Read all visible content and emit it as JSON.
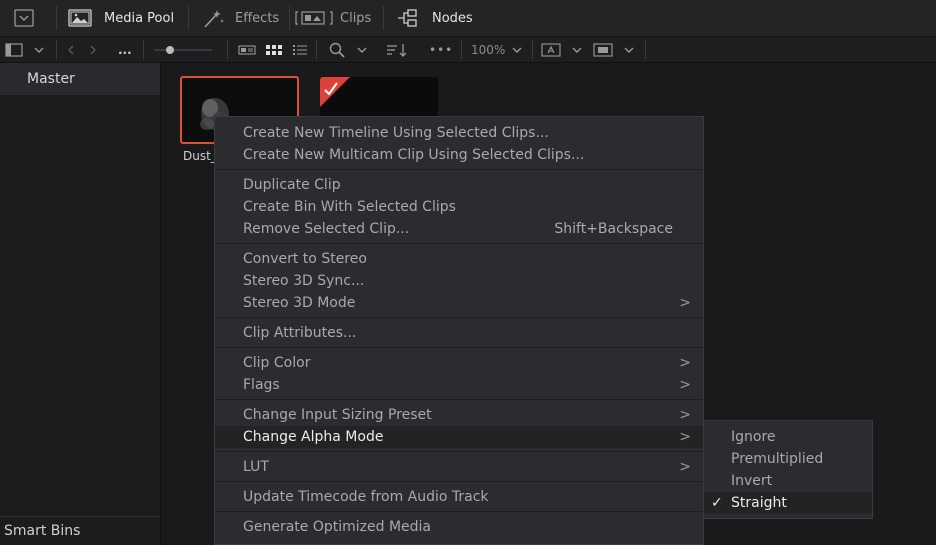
{
  "topbar": {
    "media_pool": "Media Pool",
    "effects": "Effects",
    "clips": "Clips",
    "nodes": "Nodes"
  },
  "toolbar": {
    "path_ellipsis": "...",
    "more": "•••",
    "zoom": "100%"
  },
  "sidebar": {
    "master": "Master",
    "smart_bins": "Smart Bins"
  },
  "clip": {
    "name": "Dust_"
  },
  "context_menu": {
    "items": [
      {
        "label": "Create New Timeline Using Selected Clips..."
      },
      {
        "label": "Create New Multicam Clip Using Selected Clips..."
      },
      {
        "label": "Duplicate Clip"
      },
      {
        "label": "Create Bin With Selected Clips"
      },
      {
        "label": "Remove Selected Clip...",
        "shortcut": "Shift+Backspace"
      },
      {
        "label": "Convert to Stereo"
      },
      {
        "label": "Stereo 3D Sync..."
      },
      {
        "label": "Stereo 3D Mode"
      },
      {
        "label": "Clip Attributes..."
      },
      {
        "label": "Clip Color"
      },
      {
        "label": "Flags"
      },
      {
        "label": "Change Input Sizing Preset"
      },
      {
        "label": "Change Alpha Mode"
      },
      {
        "label": "LUT"
      },
      {
        "label": "Update Timecode from Audio Track"
      },
      {
        "label": "Generate Optimized Media"
      }
    ]
  },
  "alpha_submenu": {
    "items": [
      {
        "label": "Ignore"
      },
      {
        "label": "Premultiplied"
      },
      {
        "label": "Invert"
      },
      {
        "label": "Straight",
        "checked": true
      }
    ]
  },
  "colors": {
    "selection_border": "#e0502f",
    "flag_red": "#e0403a",
    "menu_bg": "#2c2c30"
  }
}
